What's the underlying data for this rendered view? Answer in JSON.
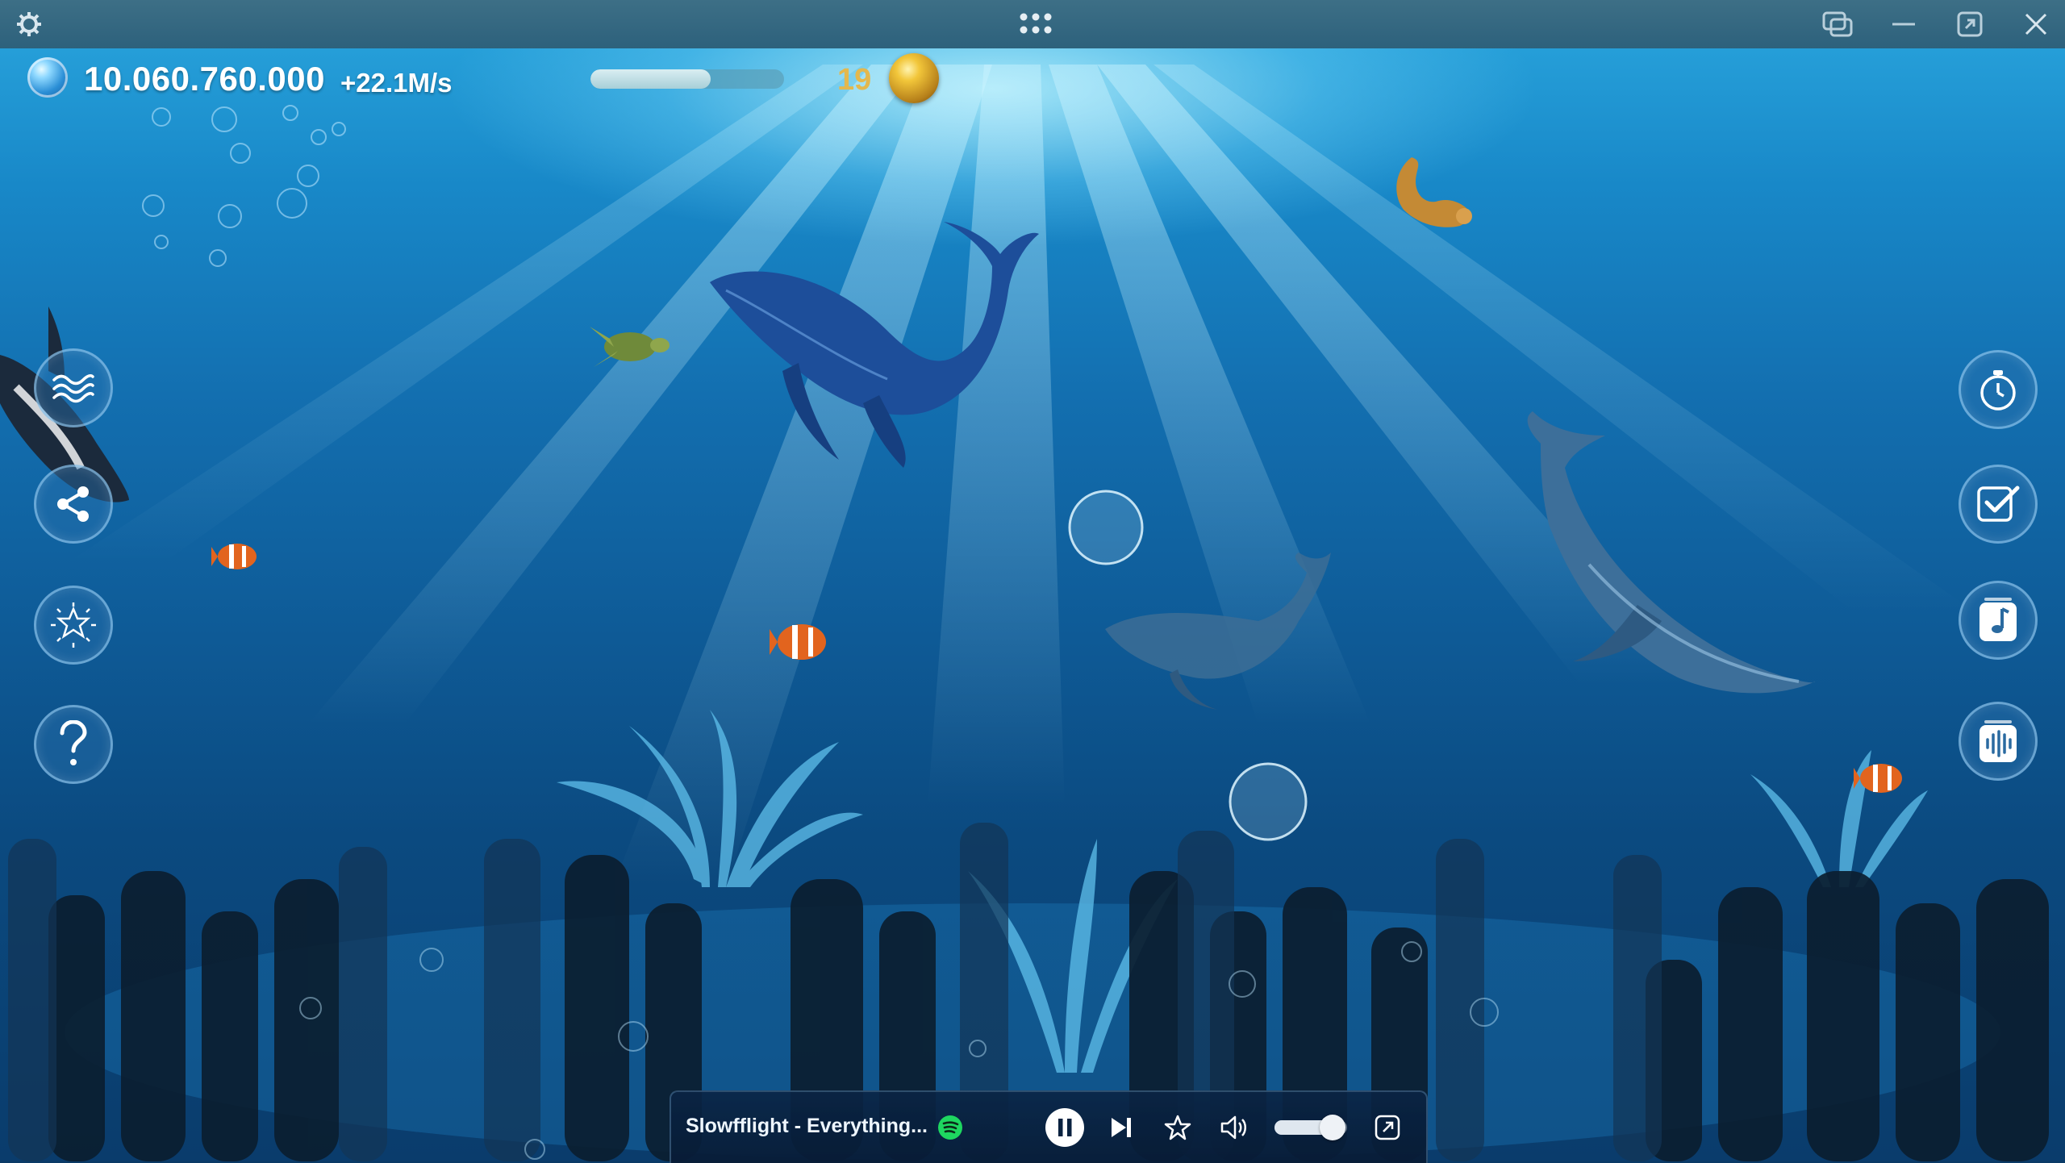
{
  "window": {
    "icons": [
      "settings-gear-icon",
      "app-grid-icon",
      "picture-in-picture-icon",
      "minimize-icon",
      "restore-icon",
      "close-icon"
    ]
  },
  "hud": {
    "score": "10.060.760.000",
    "rate": "+22.1M/s",
    "level_progress": 0.62,
    "gold_count": "19"
  },
  "left_menu": [
    "waves-icon",
    "share-icon",
    "sparkle-icon",
    "help-icon"
  ],
  "right_menu": [
    "stopwatch-icon",
    "checklist-icon",
    "music-note-icon",
    "ambient-sound-icon"
  ],
  "player": {
    "track": "Slowfflight - Everything...",
    "source": "spotify-icon",
    "volume": 0.8
  },
  "colors": {
    "gold": "#e3b84e",
    "spotify_green": "#1ed760"
  }
}
